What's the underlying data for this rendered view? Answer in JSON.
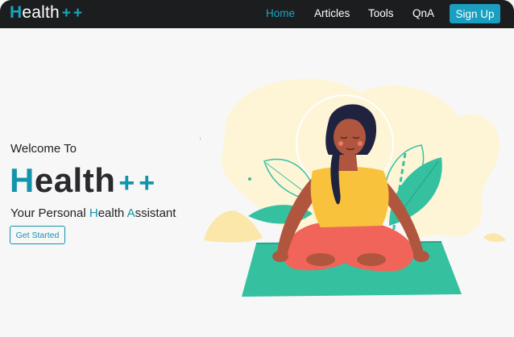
{
  "navbar": {
    "brand_h": "H",
    "brand_rest": "ealth",
    "brand_plus": "++",
    "links": [
      {
        "label": "Home",
        "active": true
      },
      {
        "label": "Articles",
        "active": false
      },
      {
        "label": "Tools",
        "active": false
      },
      {
        "label": "QnA",
        "active": false
      }
    ],
    "signup_label": "Sign Up"
  },
  "hero": {
    "welcome": "Welcome To",
    "title_h": "H",
    "title_rest": "ealth",
    "title_plus": "++",
    "tagline_part1": "Your Personal ",
    "tagline_h": "H",
    "tagline_part2": "ealth ",
    "tagline_a": "A",
    "tagline_part3": "ssistant",
    "cta_label": "Get Started"
  },
  "colors": {
    "accent": "#1394ad",
    "nav_bg": "#1c1d1f",
    "signup_bg": "#1a9fc0",
    "mat": "#35c1a0",
    "shirt": "#f9c23c",
    "pants": "#f0645a"
  },
  "illustration": {
    "subject": "meditating-woman-illustration"
  }
}
